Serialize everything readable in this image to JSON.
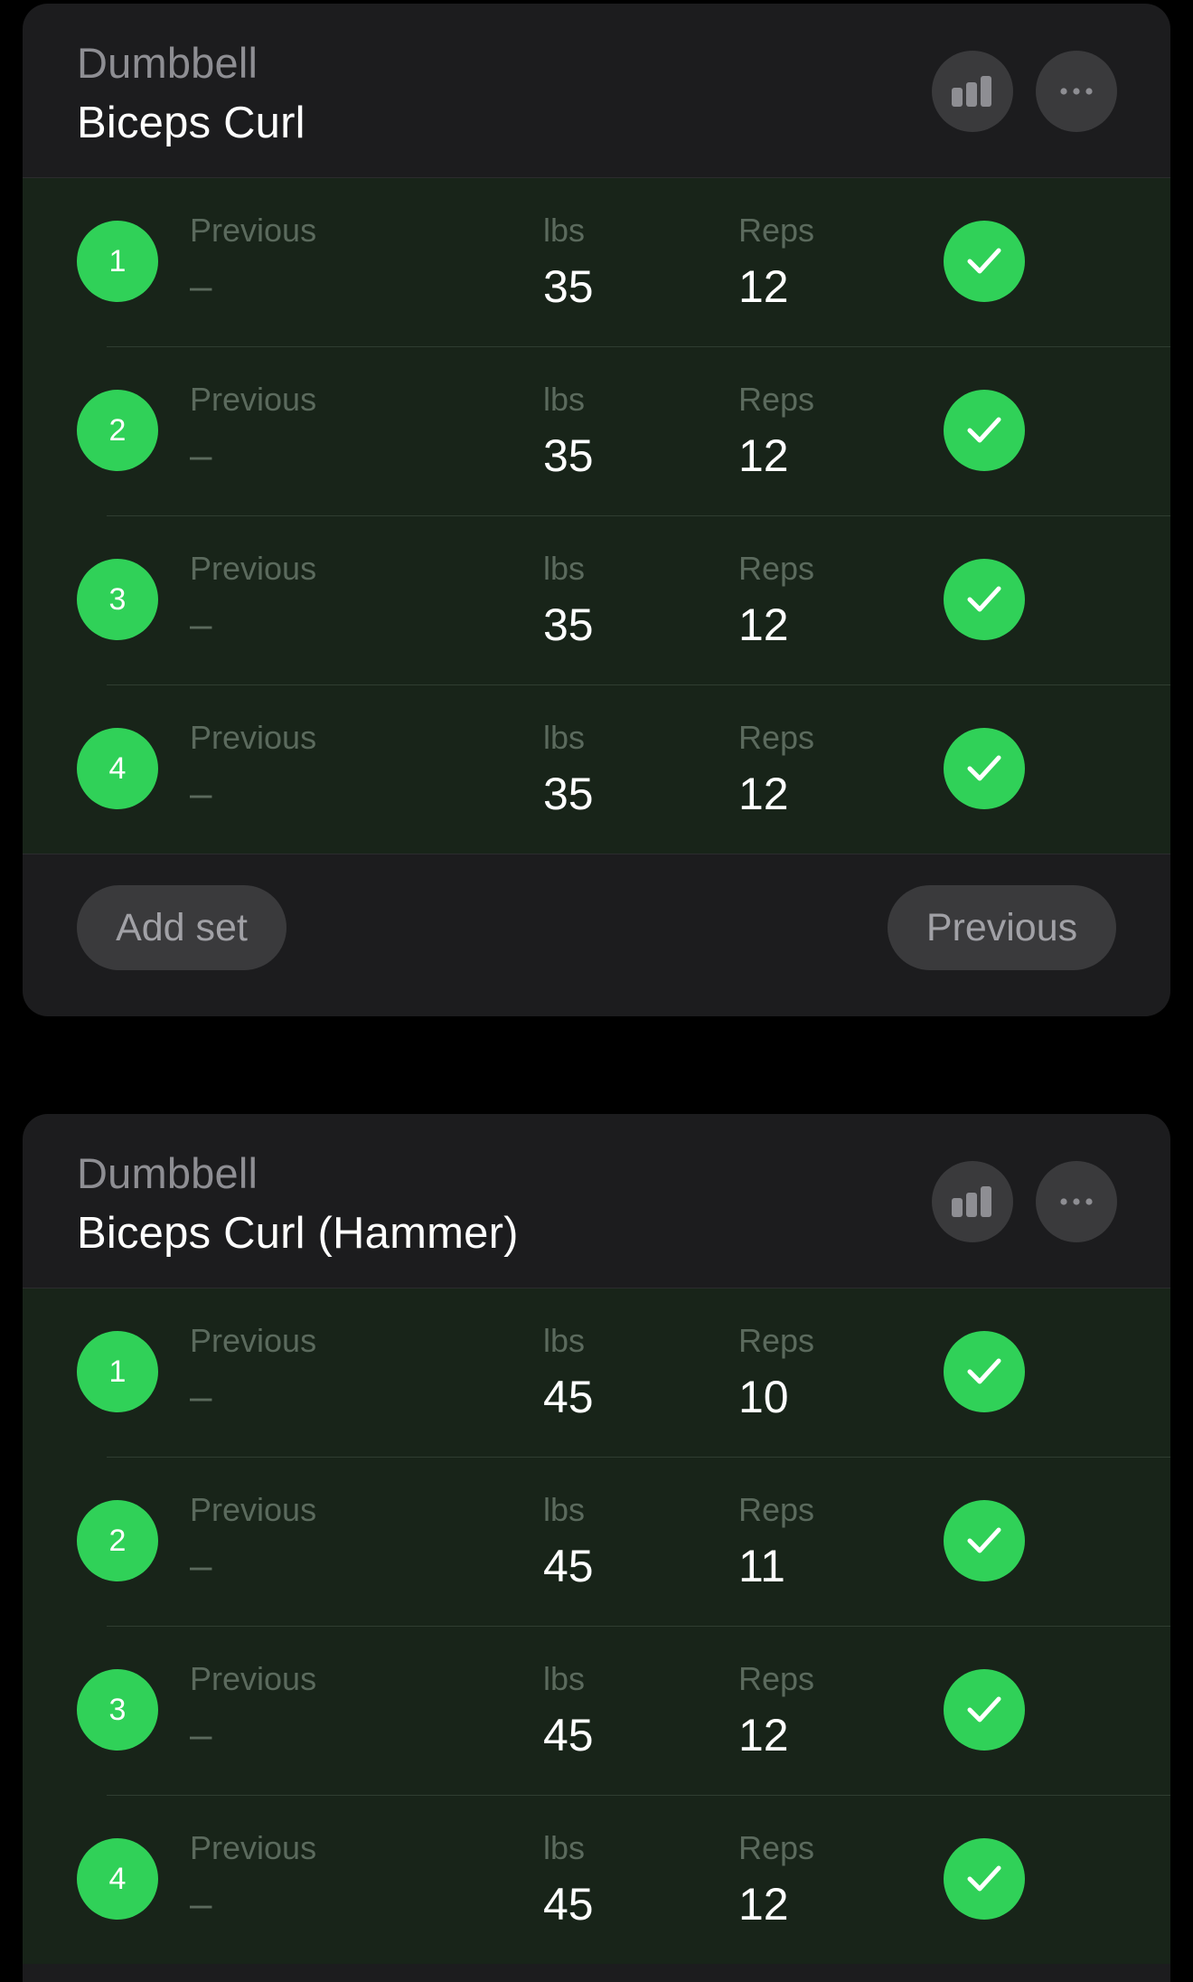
{
  "exercises": [
    {
      "equipment": "Dumbbell",
      "name": "Biceps Curl",
      "labels": {
        "previous": "Previous",
        "lbs": "lbs",
        "reps": "Reps"
      },
      "sets": [
        {
          "number": "1",
          "previous": "–",
          "lbs": "35",
          "reps": "12",
          "completed": true
        },
        {
          "number": "2",
          "previous": "–",
          "lbs": "35",
          "reps": "12",
          "completed": true
        },
        {
          "number": "3",
          "previous": "–",
          "lbs": "35",
          "reps": "12",
          "completed": true
        },
        {
          "number": "4",
          "previous": "–",
          "lbs": "35",
          "reps": "12",
          "completed": true
        }
      ],
      "footer": {
        "add_set": "Add set",
        "previous": "Previous"
      }
    },
    {
      "equipment": "Dumbbell",
      "name": "Biceps Curl (Hammer)",
      "labels": {
        "previous": "Previous",
        "lbs": "lbs",
        "reps": "Reps"
      },
      "sets": [
        {
          "number": "1",
          "previous": "–",
          "lbs": "45",
          "reps": "10",
          "completed": true
        },
        {
          "number": "2",
          "previous": "–",
          "lbs": "45",
          "reps": "11",
          "completed": true
        },
        {
          "number": "3",
          "previous": "–",
          "lbs": "45",
          "reps": "12",
          "completed": true
        },
        {
          "number": "4",
          "previous": "–",
          "lbs": "45",
          "reps": "12",
          "completed": true
        }
      ]
    }
  ],
  "icons": {
    "stats": "bar-chart-icon",
    "more": "ellipsis-icon",
    "check": "checkmark-icon"
  },
  "colors": {
    "accent_green": "#30d158",
    "completed_row_bg": "#182419",
    "card_bg": "#1c1c1e",
    "button_bg": "#3a3a3c"
  }
}
